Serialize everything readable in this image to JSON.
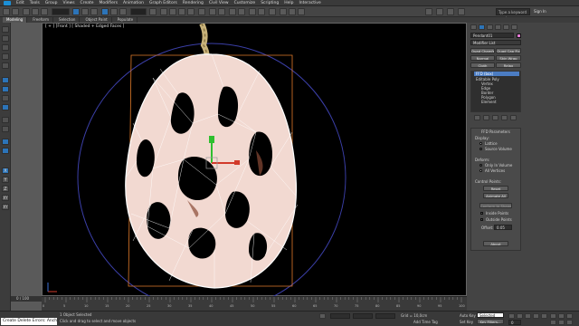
{
  "menu": {
    "items": [
      "Edit",
      "Tools",
      "Group",
      "Views",
      "Create",
      "Modifiers",
      "Animation",
      "Graph Editors",
      "Rendering",
      "Civil View",
      "Customize",
      "Scripting",
      "Help",
      "Interactive"
    ]
  },
  "toolbar": {
    "search_placeholder": "Type a keyword or phrase",
    "sign_in": "Sign In"
  },
  "ribbon": {
    "tabs": [
      "Modeling",
      "Freeform",
      "Selection",
      "Object Paint",
      "Populate"
    ]
  },
  "viewport": {
    "label": "[ + ] [Front ] [ Shaded + Edged Faces ]",
    "bg": "#000000",
    "mesh_fill": "#f2d9d1",
    "wire": "#ffffff",
    "gizmo_circle": "#3b3fa8",
    "bbox": "#e07a2a"
  },
  "left_tools": [
    "select-icon",
    "zoom-icon",
    "pan-icon",
    "move-icon",
    "rotate-icon",
    "scale-icon",
    "snap-icon",
    "percent-icon",
    "spinner-icon",
    "mirror-icon",
    "align-icon",
    "layer-icon",
    "render-icon",
    "x-axis",
    "y-axis",
    "z-axis",
    "xy-plane",
    "xy-plane-2"
  ],
  "left_tool_labels": {
    "x": "X",
    "y": "Y",
    "z": "Z",
    "xy": "XY",
    "xy2": "XY"
  },
  "command_panel": {
    "object_name": "Pendant01",
    "modifier_list": "Modifier List",
    "buttons_row1": [
      "Quad Chamfer",
      "Quad Cap Fix"
    ],
    "buttons_row2": [
      "Normal",
      "Skin Wrap"
    ],
    "buttons_row3": [
      "Cloth",
      "Relax"
    ],
    "stack": [
      "FFD (box)",
      "Editable Poly",
      "Vertex",
      "Edge",
      "Border",
      "Polygon",
      "Element"
    ],
    "rollout_title": "FFD Parameters",
    "display_label": "Display:",
    "lattice": "Lattice",
    "source_volume": "Source Volume",
    "deform_label": "Deform:",
    "only_in_volume": "Only In Volume",
    "all_vertices": "All Vertices",
    "control_points_label": "Control Points:",
    "reset": "Reset",
    "animate_all": "Animate All",
    "conform_to_shape": "Conform to Shape",
    "inside_points": "Inside Points",
    "outside_points": "Outside Points",
    "offset_label": "Offset:",
    "offset_value": "0.05",
    "about": "About"
  },
  "timeline": {
    "frame": "0 / 100",
    "ticks": [
      "0",
      "5",
      "10",
      "15",
      "20",
      "25",
      "30",
      "35",
      "40",
      "45",
      "50",
      "55",
      "60",
      "65",
      "70",
      "75",
      "80",
      "85",
      "90",
      "95",
      "100"
    ]
  },
  "status": {
    "maxscript": "Create Delete Errors: Anchor",
    "selected": "1 Object Selected",
    "prompt": "Click and drag to select and move objects",
    "grid": "Grid = 10,0cm",
    "add_time_tag": "Add Time Tag",
    "auto_key": "Auto Key",
    "selected_dd": "Selected",
    "set_key": "Set Key",
    "key_filters": "Key Filters...",
    "frame_box": "0"
  }
}
